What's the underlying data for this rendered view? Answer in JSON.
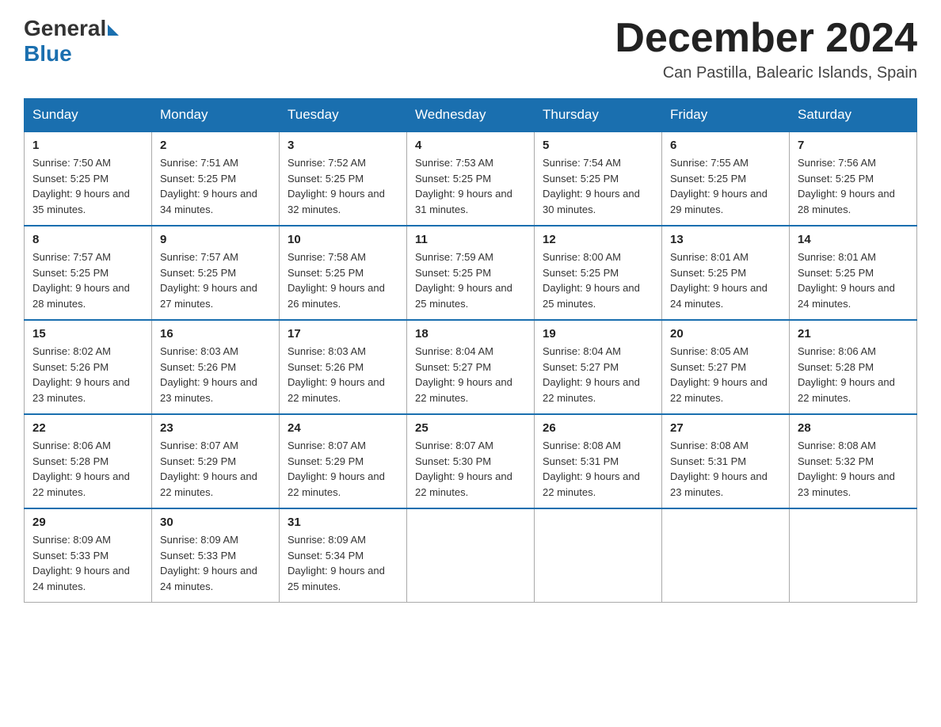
{
  "header": {
    "logo_general": "General",
    "logo_blue": "Blue",
    "month_title": "December 2024",
    "location": "Can Pastilla, Balearic Islands, Spain"
  },
  "days_of_week": [
    "Sunday",
    "Monday",
    "Tuesday",
    "Wednesday",
    "Thursday",
    "Friday",
    "Saturday"
  ],
  "weeks": [
    [
      {
        "day": "1",
        "sunrise": "7:50 AM",
        "sunset": "5:25 PM",
        "daylight": "9 hours and 35 minutes."
      },
      {
        "day": "2",
        "sunrise": "7:51 AM",
        "sunset": "5:25 PM",
        "daylight": "9 hours and 34 minutes."
      },
      {
        "day": "3",
        "sunrise": "7:52 AM",
        "sunset": "5:25 PM",
        "daylight": "9 hours and 32 minutes."
      },
      {
        "day": "4",
        "sunrise": "7:53 AM",
        "sunset": "5:25 PM",
        "daylight": "9 hours and 31 minutes."
      },
      {
        "day": "5",
        "sunrise": "7:54 AM",
        "sunset": "5:25 PM",
        "daylight": "9 hours and 30 minutes."
      },
      {
        "day": "6",
        "sunrise": "7:55 AM",
        "sunset": "5:25 PM",
        "daylight": "9 hours and 29 minutes."
      },
      {
        "day": "7",
        "sunrise": "7:56 AM",
        "sunset": "5:25 PM",
        "daylight": "9 hours and 28 minutes."
      }
    ],
    [
      {
        "day": "8",
        "sunrise": "7:57 AM",
        "sunset": "5:25 PM",
        "daylight": "9 hours and 28 minutes."
      },
      {
        "day": "9",
        "sunrise": "7:57 AM",
        "sunset": "5:25 PM",
        "daylight": "9 hours and 27 minutes."
      },
      {
        "day": "10",
        "sunrise": "7:58 AM",
        "sunset": "5:25 PM",
        "daylight": "9 hours and 26 minutes."
      },
      {
        "day": "11",
        "sunrise": "7:59 AM",
        "sunset": "5:25 PM",
        "daylight": "9 hours and 25 minutes."
      },
      {
        "day": "12",
        "sunrise": "8:00 AM",
        "sunset": "5:25 PM",
        "daylight": "9 hours and 25 minutes."
      },
      {
        "day": "13",
        "sunrise": "8:01 AM",
        "sunset": "5:25 PM",
        "daylight": "9 hours and 24 minutes."
      },
      {
        "day": "14",
        "sunrise": "8:01 AM",
        "sunset": "5:25 PM",
        "daylight": "9 hours and 24 minutes."
      }
    ],
    [
      {
        "day": "15",
        "sunrise": "8:02 AM",
        "sunset": "5:26 PM",
        "daylight": "9 hours and 23 minutes."
      },
      {
        "day": "16",
        "sunrise": "8:03 AM",
        "sunset": "5:26 PM",
        "daylight": "9 hours and 23 minutes."
      },
      {
        "day": "17",
        "sunrise": "8:03 AM",
        "sunset": "5:26 PM",
        "daylight": "9 hours and 22 minutes."
      },
      {
        "day": "18",
        "sunrise": "8:04 AM",
        "sunset": "5:27 PM",
        "daylight": "9 hours and 22 minutes."
      },
      {
        "day": "19",
        "sunrise": "8:04 AM",
        "sunset": "5:27 PM",
        "daylight": "9 hours and 22 minutes."
      },
      {
        "day": "20",
        "sunrise": "8:05 AM",
        "sunset": "5:27 PM",
        "daylight": "9 hours and 22 minutes."
      },
      {
        "day": "21",
        "sunrise": "8:06 AM",
        "sunset": "5:28 PM",
        "daylight": "9 hours and 22 minutes."
      }
    ],
    [
      {
        "day": "22",
        "sunrise": "8:06 AM",
        "sunset": "5:28 PM",
        "daylight": "9 hours and 22 minutes."
      },
      {
        "day": "23",
        "sunrise": "8:07 AM",
        "sunset": "5:29 PM",
        "daylight": "9 hours and 22 minutes."
      },
      {
        "day": "24",
        "sunrise": "8:07 AM",
        "sunset": "5:29 PM",
        "daylight": "9 hours and 22 minutes."
      },
      {
        "day": "25",
        "sunrise": "8:07 AM",
        "sunset": "5:30 PM",
        "daylight": "9 hours and 22 minutes."
      },
      {
        "day": "26",
        "sunrise": "8:08 AM",
        "sunset": "5:31 PM",
        "daylight": "9 hours and 22 minutes."
      },
      {
        "day": "27",
        "sunrise": "8:08 AM",
        "sunset": "5:31 PM",
        "daylight": "9 hours and 23 minutes."
      },
      {
        "day": "28",
        "sunrise": "8:08 AM",
        "sunset": "5:32 PM",
        "daylight": "9 hours and 23 minutes."
      }
    ],
    [
      {
        "day": "29",
        "sunrise": "8:09 AM",
        "sunset": "5:33 PM",
        "daylight": "9 hours and 24 minutes."
      },
      {
        "day": "30",
        "sunrise": "8:09 AM",
        "sunset": "5:33 PM",
        "daylight": "9 hours and 24 minutes."
      },
      {
        "day": "31",
        "sunrise": "8:09 AM",
        "sunset": "5:34 PM",
        "daylight": "9 hours and 25 minutes."
      },
      null,
      null,
      null,
      null
    ]
  ]
}
